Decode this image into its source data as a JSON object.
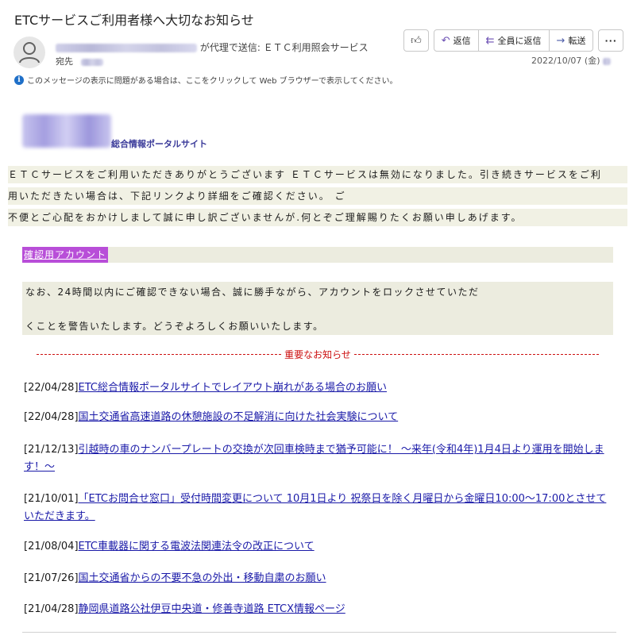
{
  "subject": "ETCサービスご利用者様へ大切なお知らせ",
  "header": {
    "sender_suffix": "が代理で送信: ＥＴＣ利用照会サービス",
    "to_label": "宛先",
    "date": "2022/10/07 (金)",
    "actions": {
      "reply": "返信",
      "reply_all": "全員に返信",
      "forward": "転送"
    },
    "info_text": "このメッセージの表示に問題がある場合は、ここをクリックして Web ブラウザーで表示してください。"
  },
  "body": {
    "portal_text": "総合情報ポータルサイト",
    "paragraph_lines": [
      "ＥＴＣサービスをご利用いただきありがとうございます ＥＴＣサービスは無効になりました。引き続きサービスをご利",
      "用いただきたい場合は、下記リンクより詳細をご確認ください。 ご",
      "不便とご心配をおかけしまして誠に申し訳ございませんが.何とぞご理解賜りたくお願い申しあげます。"
    ],
    "confirm_link": "確認用アカウント",
    "warning_lines": [
      "なお、24時間以内にご確認できない場合、誠に勝手ながら、アカウントをロックさせていただ",
      "くことを警告いたします。どうぞよろしくお願いいたします。"
    ],
    "notice_heading": "重要なお知らせ",
    "news": [
      {
        "date": "[22/04/28]",
        "text": "ETC総合情報ポータルサイトでレイアウト崩れがある場合のお願い"
      },
      {
        "date": "[22/04/28]",
        "text": "国土交通省高速道路の休憩施設の不足解消に向けた社会実験について"
      },
      {
        "date": "[21/12/13]",
        "text": "引越時の車のナンバープレートの交換が次回車検時まで猶予可能に！ ～来年(令和4年)1月4日より運用を開始します！～"
      },
      {
        "date": "[21/10/01]",
        "text": "「ETCお問合せ窓口」受付時間変更について 10月1日より 祝祭日を除く月曜日から金曜日10:00～17:00とさせていただきます。"
      },
      {
        "date": "[21/08/04]",
        "text": "ETC車載器に関する電波法関連法令の改正について"
      },
      {
        "date": "[21/07/26]",
        "text": "国土交通省からの不要不急の外出・移動自粛のお願い"
      },
      {
        "date": "[21/04/28]",
        "text": "静岡県道路公社伊豆中央道・修善寺道路 ETCX情報ページ"
      }
    ]
  }
}
